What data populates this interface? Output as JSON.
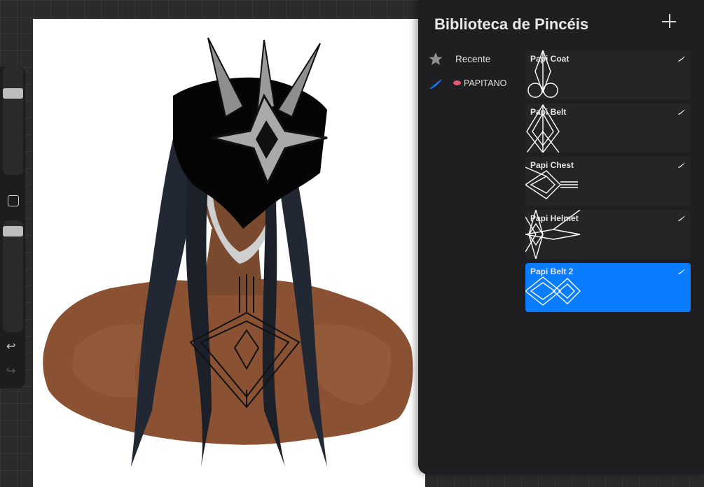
{
  "panel": {
    "title": "Biblioteca de Pincéis",
    "add_icon": "plus-icon"
  },
  "brush_sets": [
    {
      "label": "Recente",
      "icon": "star-icon",
      "selected": false
    },
    {
      "label": "PAPITANO",
      "icon": "brush-stroke-icon",
      "emoji": "lips-emoji",
      "selected": true
    }
  ],
  "brushes": [
    {
      "name": "Papi Coat",
      "selected": false
    },
    {
      "name": "Papi Belt",
      "selected": false
    },
    {
      "name": "Papi Chest",
      "selected": false
    },
    {
      "name": "Papi Helmet",
      "selected": false
    },
    {
      "name": "Papi Belt 2",
      "selected": true
    }
  ],
  "sidebar": {
    "icons": [
      "brush-size-slider",
      "modify-icon",
      "opacity-slider",
      "undo-icon",
      "redo-icon"
    ]
  },
  "colors": {
    "accent": "#0a7cff",
    "panel_bg": "#1f1f21",
    "canvas_bg": "#ffffff"
  }
}
